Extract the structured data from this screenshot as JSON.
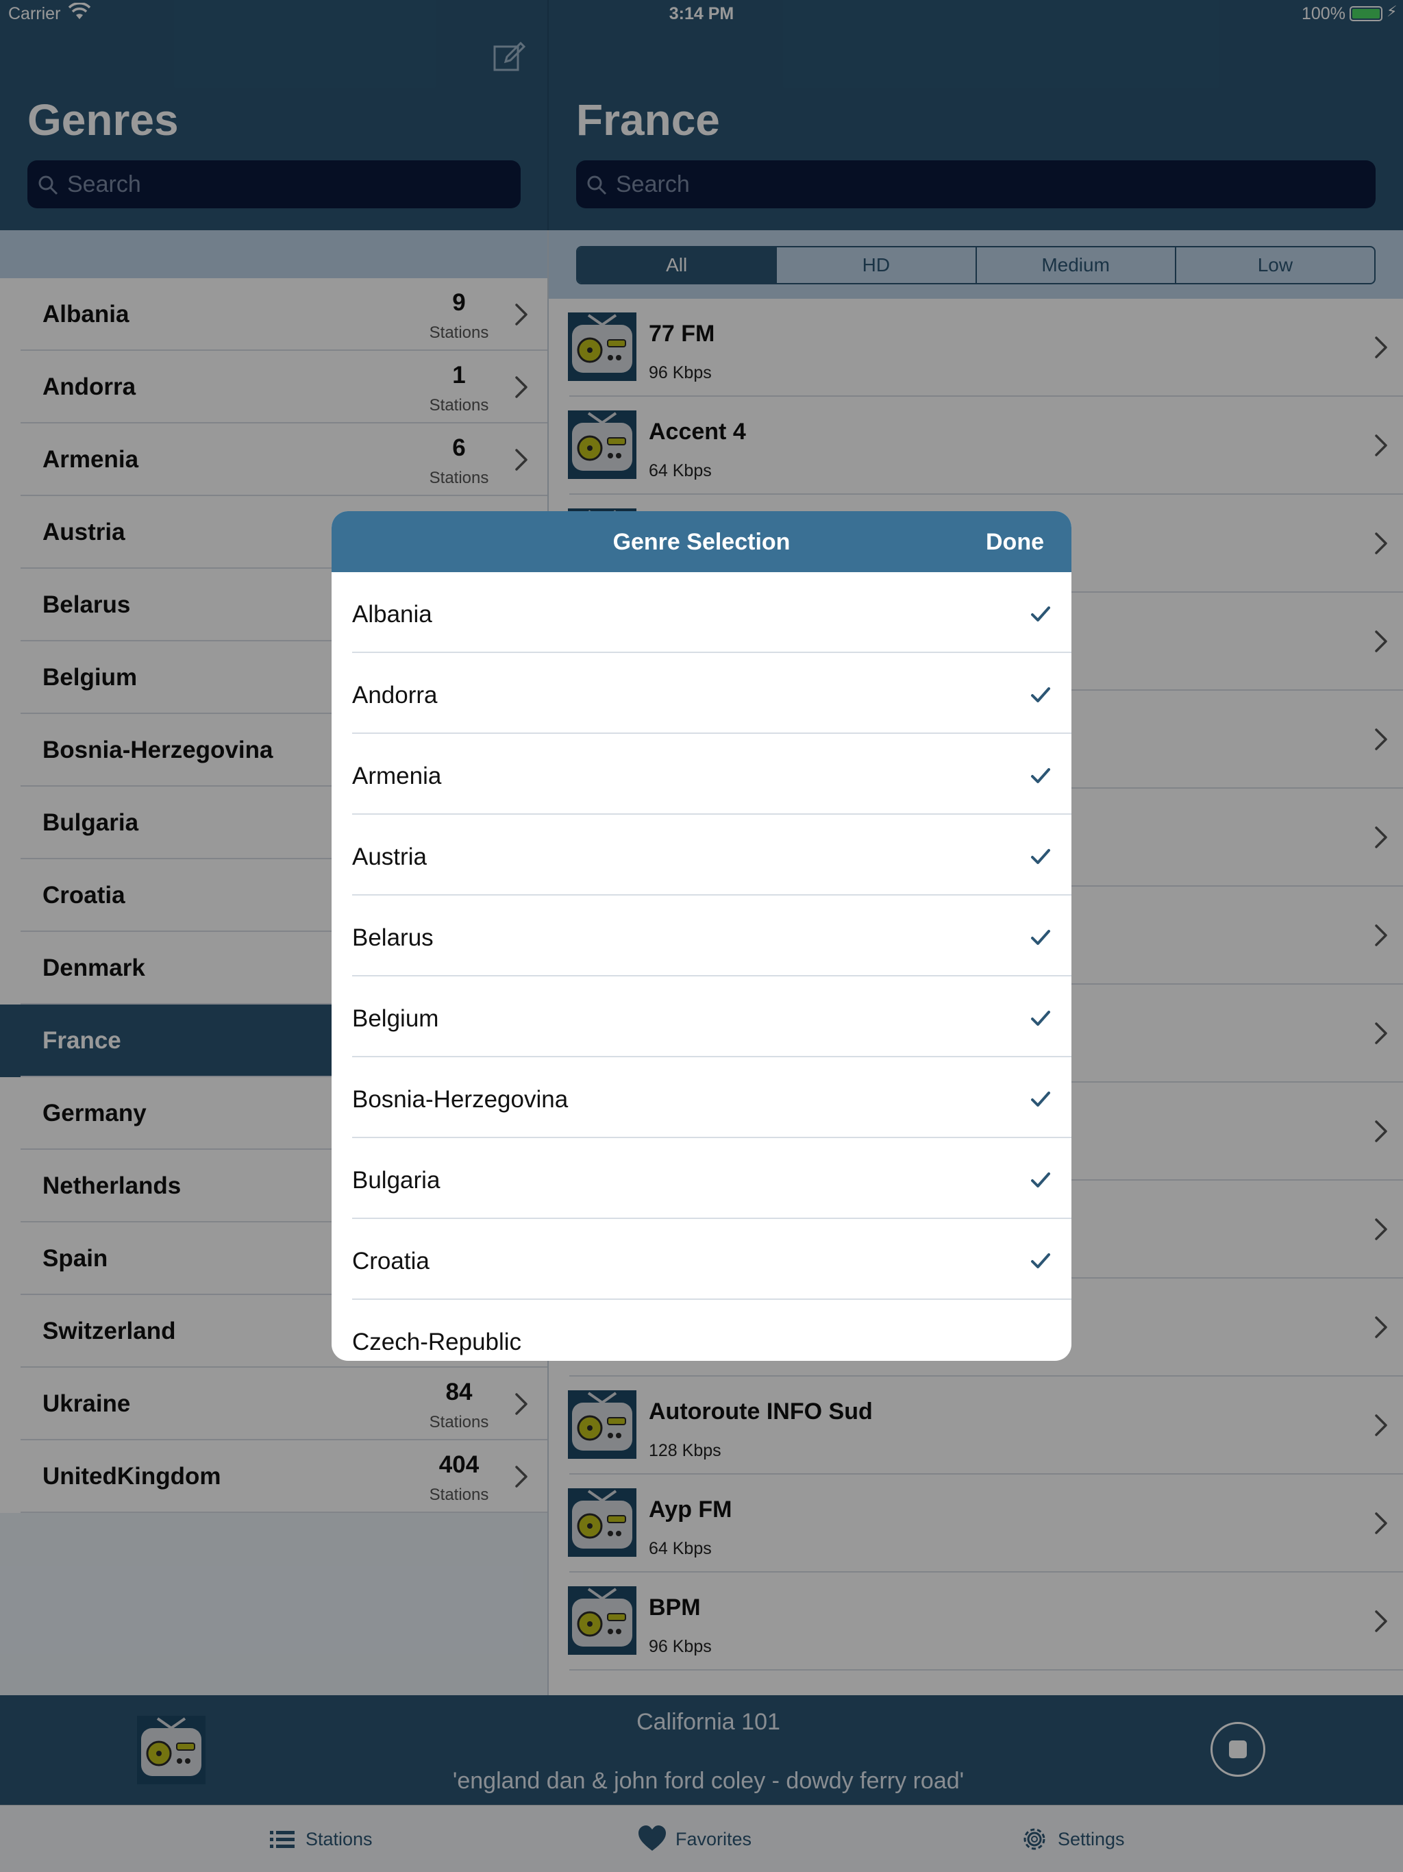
{
  "status_bar": {
    "carrier": "Carrier",
    "time": "3:14 PM",
    "battery": "100%"
  },
  "left_header": {
    "title": "Genres",
    "search_placeholder": "Search"
  },
  "right_header": {
    "title": "France",
    "search_placeholder": "Search"
  },
  "genres": [
    {
      "name": "Albania",
      "count": "9",
      "unit": "Stations"
    },
    {
      "name": "Andorra",
      "count": "1",
      "unit": "Stations"
    },
    {
      "name": "Armenia",
      "count": "6",
      "unit": "Stations"
    },
    {
      "name": "Austria"
    },
    {
      "name": "Belarus"
    },
    {
      "name": "Belgium"
    },
    {
      "name": "Bosnia-Herzegovina"
    },
    {
      "name": "Bulgaria"
    },
    {
      "name": "Croatia"
    },
    {
      "name": "Denmark"
    },
    {
      "name": "France",
      "selected": true
    },
    {
      "name": "Germany"
    },
    {
      "name": "Netherlands"
    },
    {
      "name": "Spain"
    },
    {
      "name": "Switzerland"
    },
    {
      "name": "Ukraine",
      "count": "84",
      "unit": "Stations"
    },
    {
      "name": "UnitedKingdom",
      "count": "404",
      "unit": "Stations"
    }
  ],
  "quality_filter": {
    "options": [
      "All",
      "HD",
      "Medium",
      "Low"
    ],
    "selected": "All"
  },
  "stations": [
    {
      "name": "77 FM",
      "bitrate": "96 Kbps"
    },
    {
      "name": "Accent 4",
      "bitrate": "64 Kbps"
    },
    {
      "name": "",
      "bitrate": ""
    },
    {
      "name": "",
      "bitrate": ""
    },
    {
      "name": "",
      "bitrate": ""
    },
    {
      "name": "",
      "bitrate": ""
    },
    {
      "name": "",
      "bitrate": ""
    },
    {
      "name": "",
      "bitrate": ""
    },
    {
      "name": "",
      "bitrate": ""
    },
    {
      "name": "",
      "bitrate": ""
    },
    {
      "name": "",
      "bitrate": ""
    },
    {
      "name": "Autoroute INFO Sud",
      "bitrate": "128 Kbps"
    },
    {
      "name": "Ayp FM",
      "bitrate": "64 Kbps"
    },
    {
      "name": "BPM",
      "bitrate": "96 Kbps"
    }
  ],
  "modal": {
    "title": "Genre Selection",
    "done_label": "Done",
    "items": [
      {
        "name": "Albania",
        "checked": true
      },
      {
        "name": "Andorra",
        "checked": true
      },
      {
        "name": "Armenia",
        "checked": true
      },
      {
        "name": "Austria",
        "checked": true
      },
      {
        "name": "Belarus",
        "checked": true
      },
      {
        "name": "Belgium",
        "checked": true
      },
      {
        "name": "Bosnia-Herzegovina",
        "checked": true
      },
      {
        "name": "Bulgaria",
        "checked": true
      },
      {
        "name": "Croatia",
        "checked": true
      },
      {
        "name": "Czech-Republic",
        "checked": false
      }
    ]
  },
  "player": {
    "station": "California 101",
    "track": "'england dan & john ford coley - dowdy ferry road'"
  },
  "tabs": [
    {
      "label": "Stations",
      "icon": "list-icon"
    },
    {
      "label": "Favorites",
      "icon": "heart-icon"
    },
    {
      "label": "Settings",
      "icon": "gear-icon"
    }
  ],
  "colors": {
    "header": "#2c5674",
    "modal_header": "#3a7094",
    "accent": "#2c5674",
    "battery": "#4cd964"
  }
}
